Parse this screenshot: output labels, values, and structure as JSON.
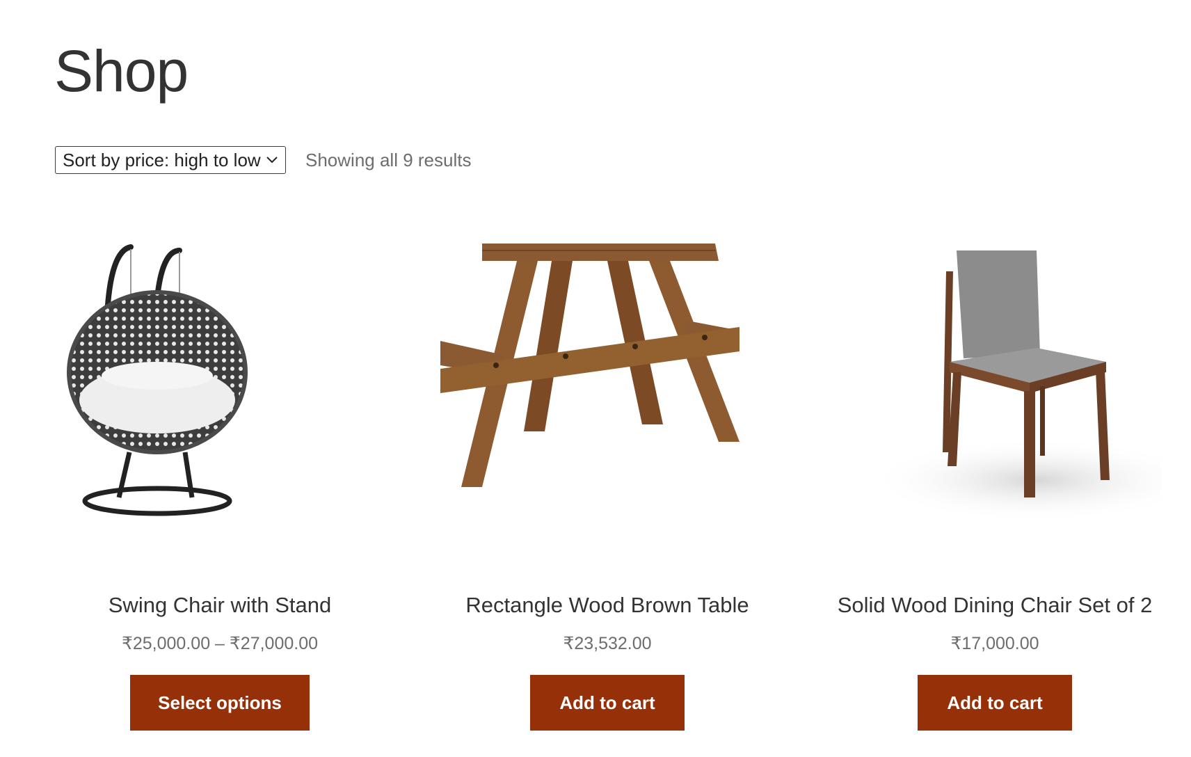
{
  "page": {
    "title": "Shop"
  },
  "toolbar": {
    "sort_selected": "Sort by price: high to low",
    "result_count": "Showing all 9 results"
  },
  "icons": {
    "sort_chevron": "chevron-down-icon"
  },
  "colors": {
    "button_bg": "#963009",
    "button_text": "#ffffff",
    "price_text": "#6d6d6d"
  },
  "products": [
    {
      "name": "Swing Chair with Stand",
      "price": "₹25,000.00 – ₹27,000.00",
      "button_label": "Select options",
      "image": "swing-chair-image"
    },
    {
      "name": "Rectangle Wood Brown Table",
      "price": "₹23,532.00",
      "button_label": "Add to cart",
      "image": "picnic-table-image"
    },
    {
      "name": "Solid Wood Dining Chair Set of 2",
      "price": "₹17,000.00",
      "button_label": "Add to cart",
      "image": "dining-chair-image"
    }
  ]
}
